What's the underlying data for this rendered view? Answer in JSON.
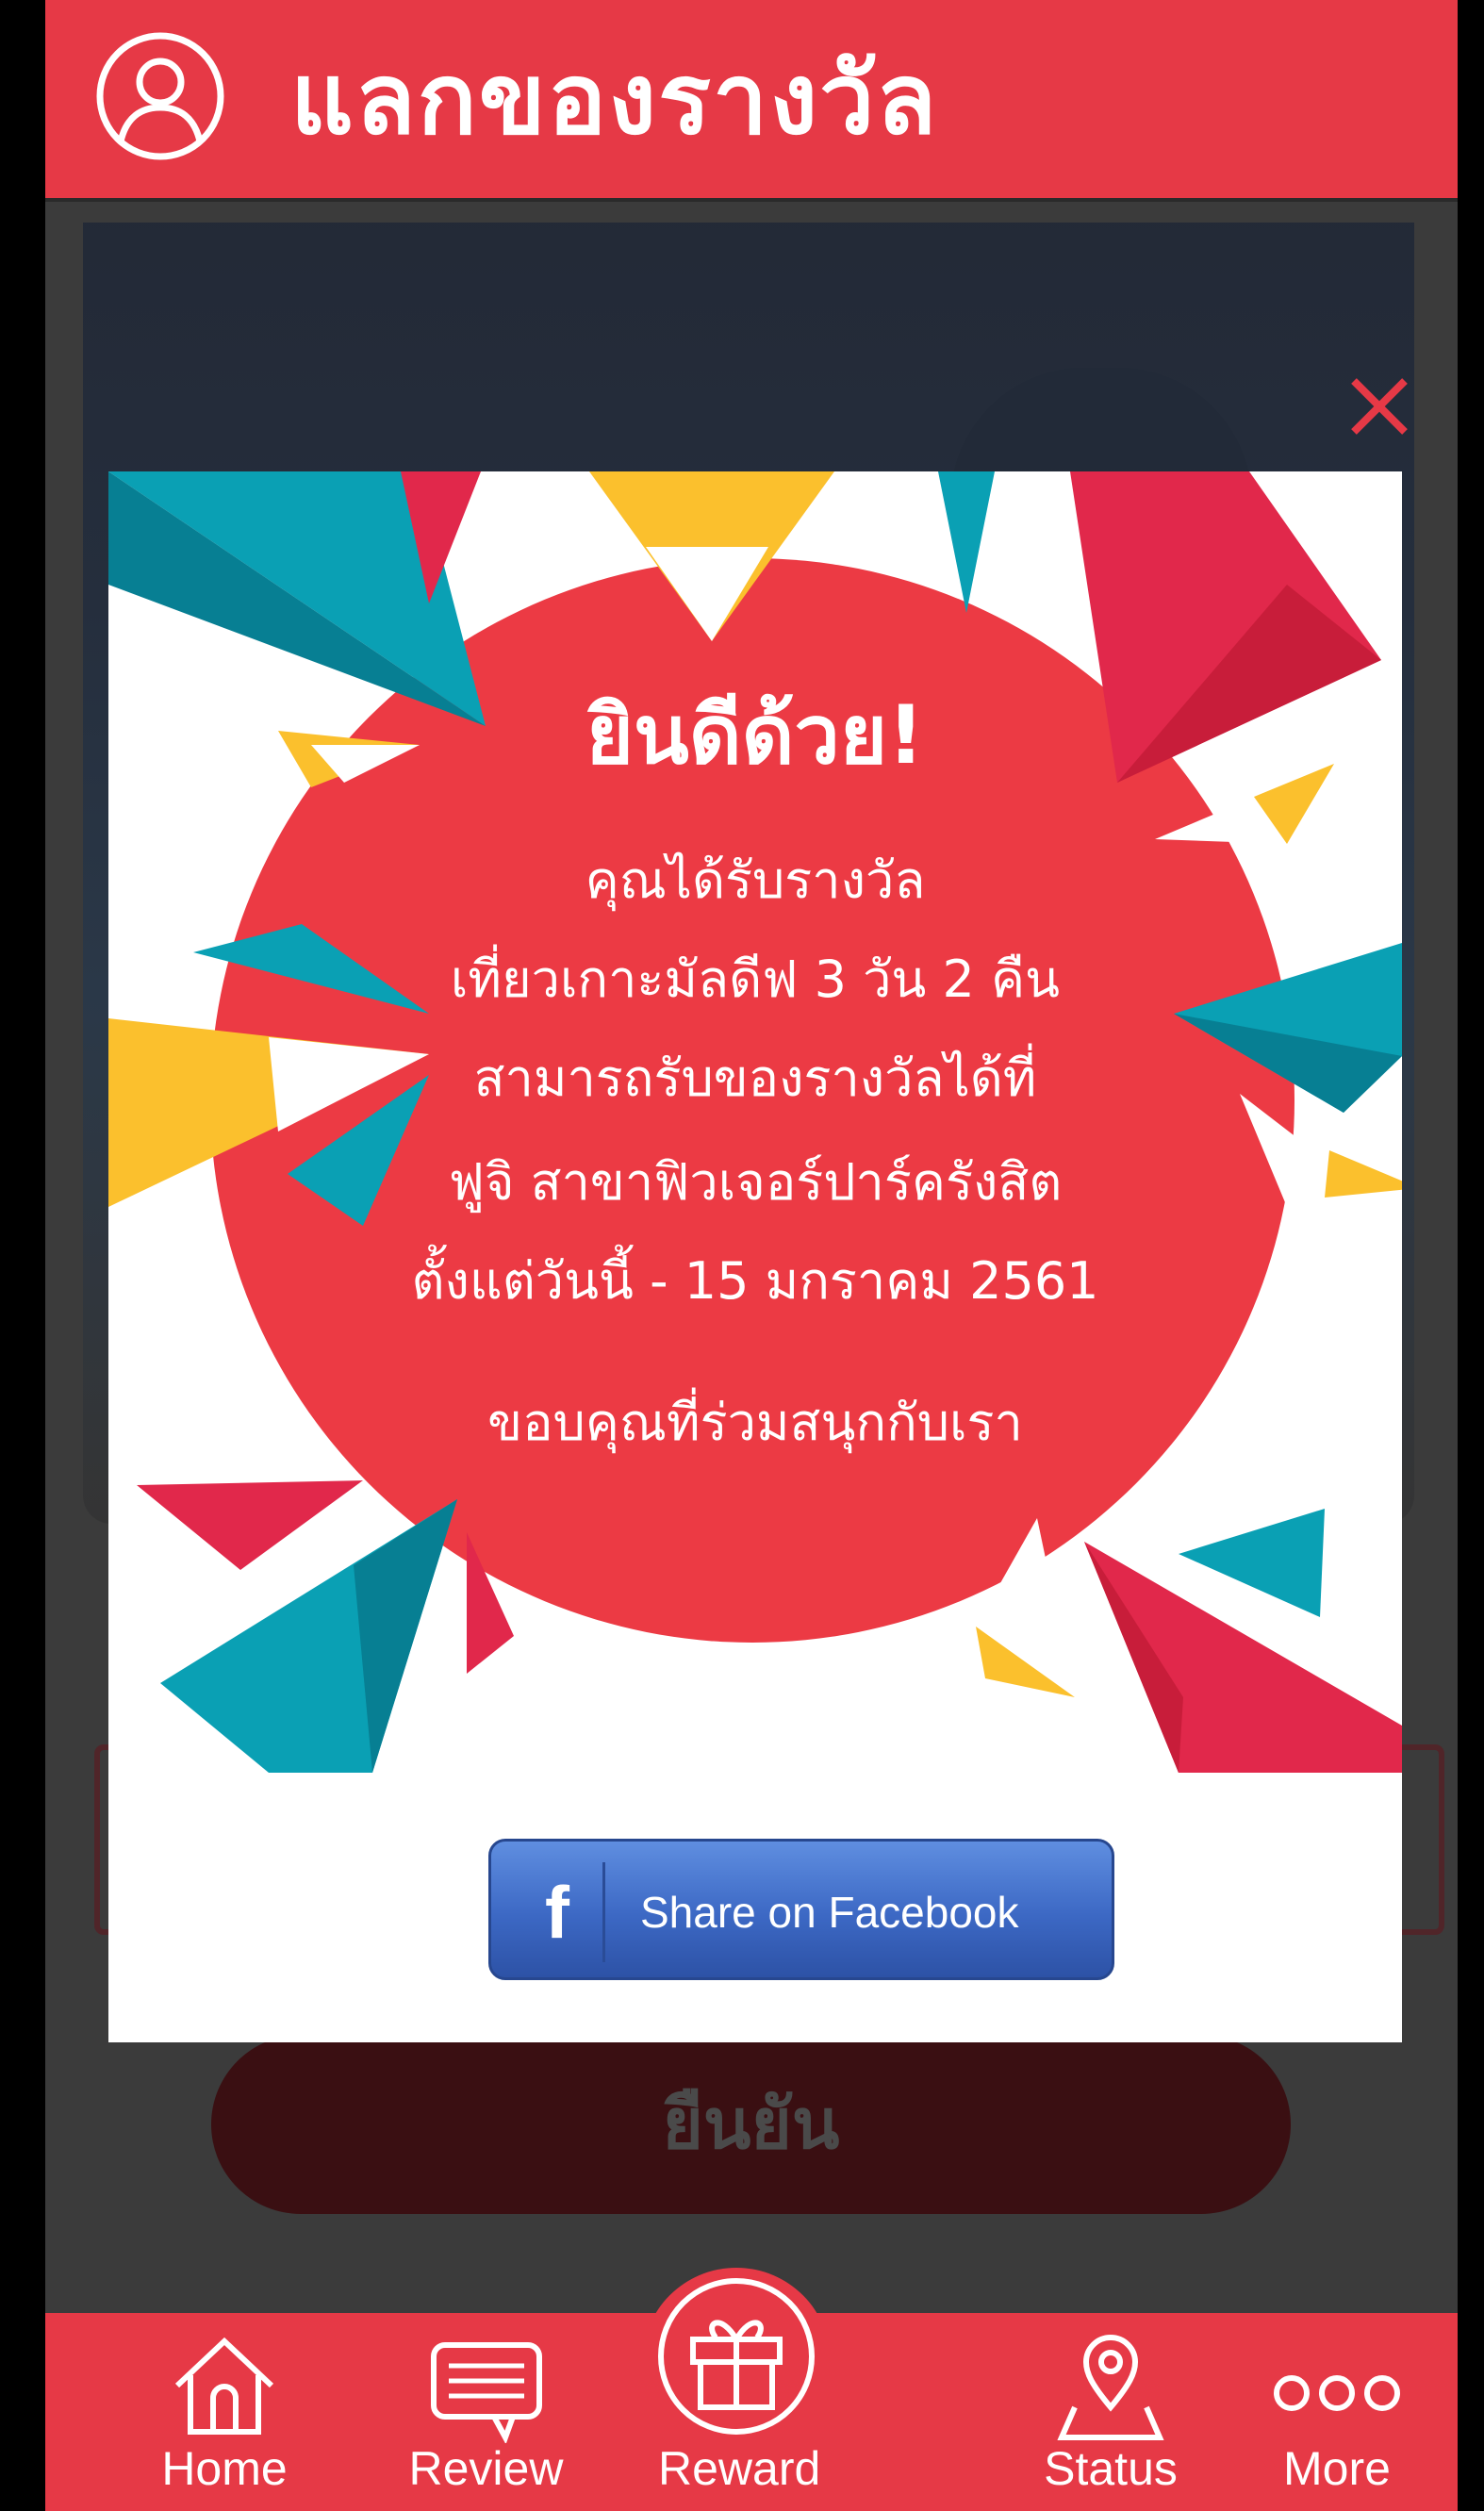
{
  "header": {
    "title": "แลกของรางวัล",
    "profile_icon": "user-circle-icon"
  },
  "background": {
    "confirm_label": "ยืนยัน"
  },
  "modal": {
    "close_icon": "close-icon",
    "heading": "ยินดีด้วย!",
    "lines": [
      "คุณได้รับรางวัล",
      "เที่ยวเกาะมัลดีฟ 3 วัน 2 คืน",
      "สามารถรับของรางวัลได้ที่",
      "ฟูจิ สาขาฟิวเจอร์ปาร์ครังสิต",
      "ตั้งแต่วันนี้ - 15 มกราคม 2561"
    ],
    "thanks": "ขอบคุณที่ร่วมสนุกกับเรา",
    "share_button": {
      "logo": "f",
      "label": "Share on Facebook"
    }
  },
  "bottom_nav": {
    "items": [
      {
        "label": "Home",
        "icon": "home-icon"
      },
      {
        "label": "Review",
        "icon": "chat-bubble-icon"
      },
      {
        "label": "Reward",
        "icon": "gift-icon",
        "active": true
      },
      {
        "label": "Status",
        "icon": "map-pin-icon"
      },
      {
        "label": "More",
        "icon": "more-dots-icon"
      }
    ]
  },
  "colors": {
    "brand_red": "#e63946",
    "circle_red": "#ec3a44",
    "teal": "#0aa0b4",
    "yellow": "#fbc02d",
    "crimson": "#e1284b",
    "facebook_blue": "#3c68c4"
  }
}
